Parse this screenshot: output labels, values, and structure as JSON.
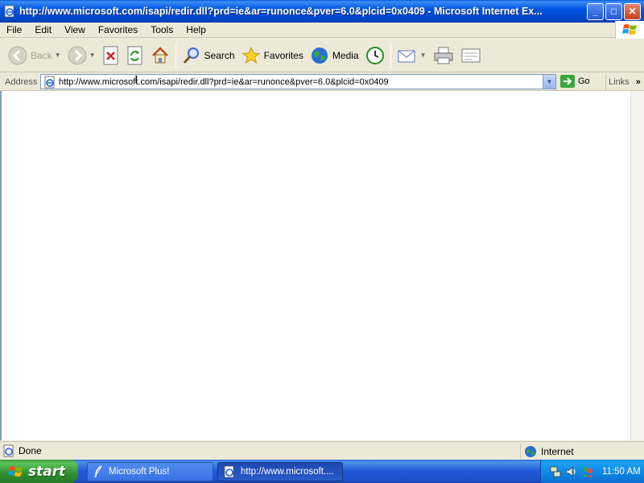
{
  "window": {
    "title": "http://www.microsoft.com/isapi/redir.dll?prd=ie&ar=runonce&pver=6.0&plcid=0x0409 - Microsoft Internet Ex...",
    "minimize": "_",
    "maximize": "□",
    "close": "✕"
  },
  "menu": {
    "items": [
      "File",
      "Edit",
      "View",
      "Favorites",
      "Tools",
      "Help"
    ]
  },
  "toolbar": {
    "back_label": "Back",
    "search_label": "Search",
    "favorites_label": "Favorites",
    "media_label": "Media"
  },
  "address": {
    "label": "Address",
    "url": "http://www.microsoft.com/isapi/redir.dll?prd=ie&ar=runonce&pver=6.0&plcid=0x0409",
    "go_label": "Go",
    "links_label": "Links",
    "links_chevron": "»"
  },
  "status": {
    "text": "Done",
    "zone": "Internet"
  },
  "taskbar": {
    "start_label": "start",
    "tasks": [
      "Microsoft Plus!",
      "http://www.microsoft...."
    ],
    "clock": "11:50 AM"
  },
  "colors": {
    "title_blue": "#0055e5",
    "taskbar_blue": "#2157d7",
    "start_green": "#2f8e2f",
    "tray_blue": "#0c7fde"
  }
}
